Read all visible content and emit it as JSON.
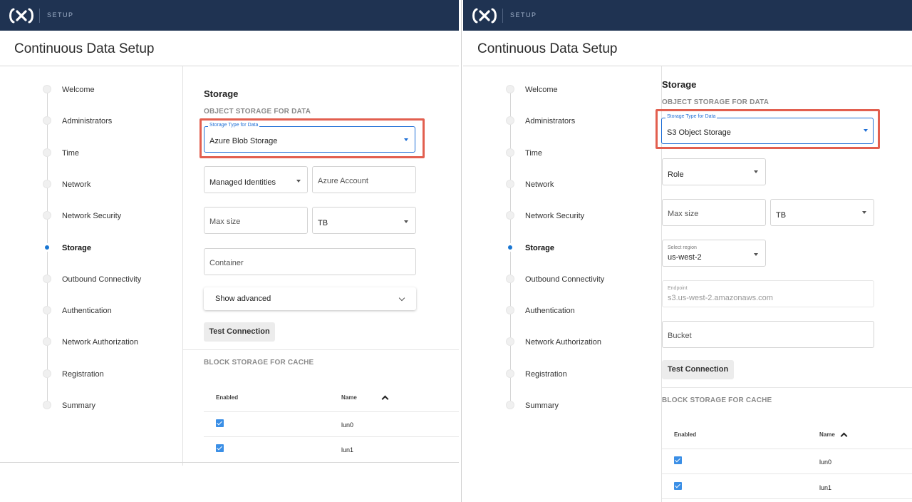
{
  "header": {
    "app_section": "SETUP",
    "page_title": "Continuous Data Setup"
  },
  "steps": [
    {
      "label": "Welcome",
      "active": false
    },
    {
      "label": "Administrators",
      "active": false
    },
    {
      "label": "Time",
      "active": false
    },
    {
      "label": "Network",
      "active": false
    },
    {
      "label": "Network Security",
      "active": false
    },
    {
      "label": "Storage",
      "active": true
    },
    {
      "label": "Outbound Connectivity",
      "active": false
    },
    {
      "label": "Authentication",
      "active": false
    },
    {
      "label": "Network Authorization",
      "active": false
    },
    {
      "label": "Registration",
      "active": false
    },
    {
      "label": "Summary",
      "active": false
    }
  ],
  "left": {
    "section_title": "Storage",
    "object_storage_heading": "OBJECT STORAGE FOR DATA",
    "storage_type_label": "Storage Type for Data",
    "storage_type_value": "Azure Blob Storage",
    "auth_value": "Managed Identities",
    "azure_account_placeholder": "Azure Account",
    "max_size_placeholder": "Max size",
    "unit_value": "TB",
    "container_placeholder": "Container",
    "show_advanced": "Show advanced",
    "test_connection": "Test Connection",
    "block_storage_heading": "BLOCK STORAGE FOR CACHE",
    "table": {
      "col_enabled": "Enabled",
      "col_name": "Name",
      "rows": [
        {
          "enabled": true,
          "name": "lun0"
        },
        {
          "enabled": true,
          "name": "lun1"
        }
      ]
    }
  },
  "right": {
    "section_title": "Storage",
    "object_storage_heading": "OBJECT STORAGE FOR DATA",
    "storage_type_label": "Storage Type for Data",
    "storage_type_value": "S3 Object Storage",
    "role_value": "Role",
    "max_size_placeholder": "Max size",
    "unit_value": "TB",
    "region_label": "Select region",
    "region_value": "us-west-2",
    "endpoint_label": "Endpoint",
    "endpoint_value": "s3.us-west-2.amazonaws.com",
    "bucket_placeholder": "Bucket",
    "test_connection": "Test Connection",
    "block_storage_heading": "BLOCK STORAGE FOR CACHE",
    "table": {
      "col_enabled": "Enabled",
      "col_name": "Name",
      "rows": [
        {
          "enabled": true,
          "name": "lun0"
        },
        {
          "enabled": true,
          "name": "lun1"
        }
      ]
    }
  },
  "colors": {
    "topbar": "#1f3352",
    "highlight": "#e25f4f",
    "accent": "#1976d2",
    "checkbox": "#3b8fe6"
  },
  "icons": [
    "cx-logo-icon",
    "caret-down-icon",
    "chevron-down-icon",
    "sort-ascending-icon",
    "checkbox-checked-icon",
    "step-dot-icon"
  ]
}
